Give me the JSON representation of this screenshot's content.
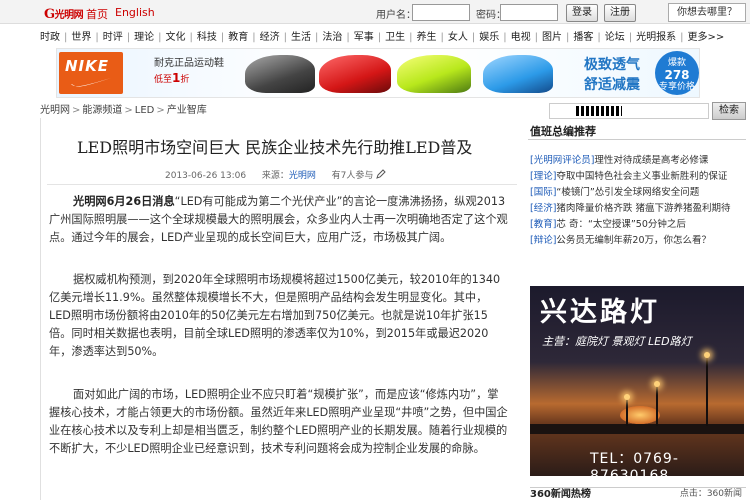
{
  "topbar": {
    "logo_text": "光明网",
    "logo_sub": "GMW.cn",
    "home_label": "首页",
    "english_label": "English",
    "username_label": "用户名：",
    "password_label": "密码：",
    "login_label": "登录",
    "register_label": "注册",
    "where_label": "你想去哪里？"
  },
  "nav": {
    "items": [
      "时政",
      "世界",
      "时评",
      "理论",
      "文化",
      "科技",
      "教育",
      "经济",
      "生活",
      "法治",
      "军事",
      "卫生",
      "养生",
      "女人",
      "娱乐",
      "电视",
      "图片",
      "播客",
      "论坛",
      "光明报系",
      "更多>>"
    ]
  },
  "banner": {
    "brand": "NIKE",
    "promo_line1": "耐克正品运动鞋",
    "promo_line2_prefix": "低至",
    "promo_line2_value": "1",
    "promo_line2_suffix": "折",
    "slogan1": "极致透气",
    "slogan2": "舒适减震",
    "sale_label": "爆款",
    "sale_price": "278",
    "sale_note": "专享价格"
  },
  "breadcrumb": {
    "items": [
      "光明网",
      "能源频道",
      "LED",
      "产业智库"
    ],
    "separator": ">"
  },
  "search": {
    "button_label": "检索"
  },
  "article": {
    "title": "LED照明市场空间巨大 民族企业技术先行助推LED普及",
    "date": "2013-06-26 13:06",
    "source_label": "来源：",
    "source": "光明网",
    "participants": "有7人参与",
    "lead_bold": "光明网6月26日消息",
    "paragraphs": [
      "“LED有可能成为第二个光伏产业”的言论一度沸沸扬扬，纵观2013广州国际照明展——这个全球规模最大的照明展会，众多业内人士再一次明确地否定了这个观点。通过今年的展会，LED产业呈现的成长空间巨大，应用广泛，市场极其广阔。",
      "据权威机构预测，到2020年全球照明市场规模将超过1500亿美元，较2010年的1340亿美元增长11.9%。虽然整体规模增长不大，但是照明产品结构会发生明显变化。其中，LED照明市场份额将由2010年的50亿美元左右增加到750亿美元。也就是说10年扩张15倍。同时相关数据也表明，目前全球LED照明的渗透率仅为10%，到2015年或最迟2020年，渗透率达到50%。",
      "面对如此广阔的市场，LED照明企业不应只盯着“规模扩张”，而是应该“修炼内功”，掌握核心技术，才能占领更大的市场份额。虽然近年来LED照明产业呈现“井喷”之势，但中国企业在核心技术以及专利上却是相当匮乏，制约整个LED照明产业的长期发展。随着行业规模的不断扩大，不少LED照明企业已经意识到，技术专利问题将会成为控制企业发展的命脉。"
    ]
  },
  "sidebar": {
    "title": "值班总编推荐",
    "items": [
      {
        "tag": "[光明网评论员]",
        "text": "理性对待成绩是高考必修课"
      },
      {
        "tag": "[理论]",
        "text": "夺取中国特色社会主义事业新胜利的保证"
      },
      {
        "tag": "[国际]",
        "text": "“棱镜门”怂引发全球网络安全问题"
      },
      {
        "tag": "[经济]",
        "text": "猪肉降量价格齐跌 猪瘟下游养猪盈利期待"
      },
      {
        "tag": "[教育]",
        "text": "芯 奇：“太空授课”50分钟之后"
      },
      {
        "tag": "[辩论]",
        "text": "公务员无编制年薪20万，你怎么看？"
      }
    ],
    "ad_title": "兴达路灯",
    "ad_subtitle": "主营：庭院灯 景观灯 LED路灯",
    "ad_phone": "TEL：0769-87630168",
    "bottom_title": "360新闻热榜",
    "bottom_right": "点击：360新闻"
  },
  "colors": {
    "brand_red": "#cc0000",
    "link_blue": "#1f5cb8",
    "nike_orange": "#e95c16",
    "slogan_blue": "#2276c4"
  }
}
